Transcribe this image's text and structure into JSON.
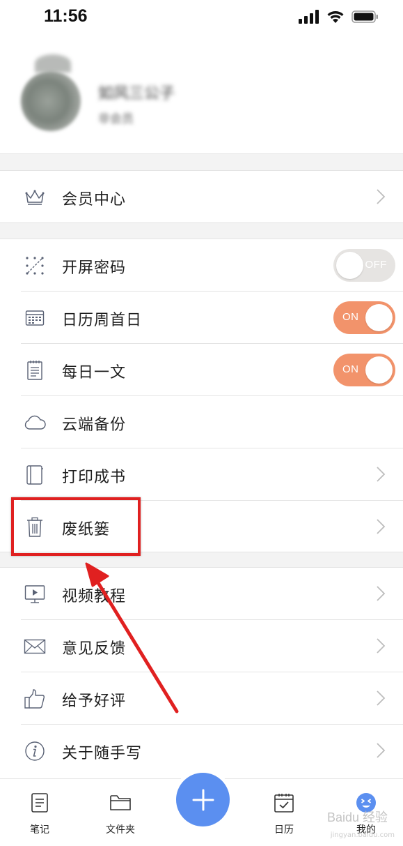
{
  "status_bar": {
    "time": "11:56"
  },
  "profile": {
    "name": "如风三公子",
    "tag": "非会员"
  },
  "menu": {
    "vip": {
      "label": "会员中心",
      "icon": "crown-icon"
    },
    "screen_lock": {
      "label": "开屏密码",
      "icon": "pattern-lock-icon",
      "toggle": "OFF"
    },
    "calendar_week": {
      "label": "日历周首日",
      "icon": "calendar-icon",
      "toggle": "ON"
    },
    "daily_article": {
      "label": "每日一文",
      "icon": "notepad-icon",
      "toggle": "ON"
    },
    "cloud_backup": {
      "label": "云端备份",
      "icon": "cloud-icon"
    },
    "print_book": {
      "label": "打印成书",
      "icon": "book-icon"
    },
    "trash": {
      "label": "废纸篓",
      "icon": "trash-icon"
    },
    "video_tutorial": {
      "label": "视频教程",
      "icon": "video-icon"
    },
    "feedback": {
      "label": "意见反馈",
      "icon": "envelope-icon"
    },
    "rate": {
      "label": "给予好评",
      "icon": "thumbs-up-icon"
    },
    "about": {
      "label": "关于随手写",
      "icon": "info-icon"
    }
  },
  "tabbar": {
    "notes": "笔记",
    "folders": "文件夹",
    "calendar": "日历",
    "mine": "我的"
  },
  "watermark": {
    "brand": "Baidu 经验",
    "url": "jingyan.baidu.com"
  },
  "colors": {
    "accent_toggle": "#f2936b",
    "fab": "#5b8ff0",
    "annotation": "#e02020"
  }
}
